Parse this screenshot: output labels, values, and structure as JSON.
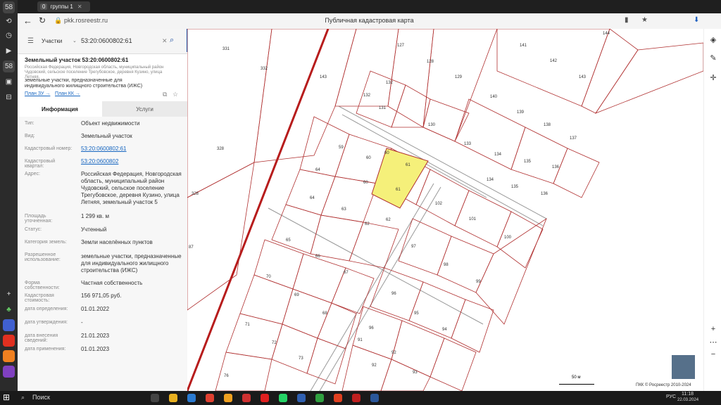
{
  "browser": {
    "tab_count": "58",
    "tab_group_count": "0",
    "tab_group_label": "группы 1",
    "url": "pkk.rosreestr.ru",
    "page_title": "Публичная кадастровая карта"
  },
  "search": {
    "type": "Участки",
    "query": "53:20:0600802:61"
  },
  "object": {
    "title": "Земельный участок 53:20:0600802:61",
    "address_short": "Российская Федерация, Новгородская область, муниципальный район Чудовский, сельское поселение Трегубовское, деревня Кузино, улица Летняя,",
    "purpose_short": "земельные участки, предназначенные для индивидуального жилищного строительства (ИЖС)",
    "plan_zu": "План ЗУ →",
    "plan_kk": "План КК →"
  },
  "tabs": {
    "info": "Информация",
    "services": "Услуги"
  },
  "fields": [
    {
      "label": "Тип:",
      "value": "Объект недвижимости"
    },
    {
      "label": "Вид:",
      "value": "Земельный участок"
    },
    {
      "label": "Кадастровый номер:",
      "value": "53:20:0600802:61"
    },
    {
      "label": "Кадастровый квартал:",
      "value": "53:20:0600802"
    },
    {
      "label": "Адрес:",
      "value": "Российская Федерация, Новгородская область, муниципальный район Чудовский, сельское поселение Трегубовское, деревня Кузино, улица Летняя, земельный участок 5"
    },
    {
      "label": "Площадь уточненная:",
      "value": "1 299 кв. м"
    },
    {
      "label": "Статус:",
      "value": "Учтенный"
    },
    {
      "label": "Категория земель:",
      "value": "Земли населённых пунктов"
    },
    {
      "label": "Разрешенное использование:",
      "value": "земельные участки, предназначенные для индивидуального жилищного строительства (ИЖС)"
    },
    {
      "label": "Форма собственности:",
      "value": "Частная собственность"
    },
    {
      "label": "Кадастровая стоимость:",
      "value": "156 971,05 руб."
    },
    {
      "label": "дата определения:",
      "value": "01.01.2022"
    },
    {
      "label": "дата утверждения:",
      "value": "-"
    },
    {
      "label": "дата внесения сведений:",
      "value": "21.01.2023"
    },
    {
      "label": "дата применения:",
      "value": "01.01.2023"
    }
  ],
  "map": {
    "selected_parcel": "61",
    "selected_color": "#f5f07a",
    "parcel_border_color": "#b03030",
    "road_color": "#b71c1c",
    "parcel_labels": [
      "331",
      "332",
      "127",
      "128",
      "129",
      "144",
      "141",
      "142",
      "143",
      "133",
      "132",
      "131",
      "130",
      "140",
      "139",
      "138",
      "137",
      "328",
      "59",
      "60",
      "61",
      "64",
      "60",
      "61",
      "133",
      "134",
      "135",
      "136",
      "134",
      "135",
      "136",
      "328",
      "64",
      "63",
      "62",
      "62",
      "102",
      "101",
      "100",
      "87",
      "65",
      "66",
      "67",
      "97",
      "98",
      "99",
      "70",
      "69",
      "68",
      "96",
      "95",
      "94",
      "71",
      "72",
      "73",
      "91",
      "92",
      "93",
      "76",
      "143",
      "101",
      "109",
      "110",
      "103",
      "16"
    ],
    "scale_label": "50 м",
    "copyright": "ПКК © Росреестр 2010-2024"
  },
  "taskbar": {
    "search_label": "Поиск",
    "lang": "РУС",
    "time": "11:18",
    "date": "22.03.2024"
  }
}
